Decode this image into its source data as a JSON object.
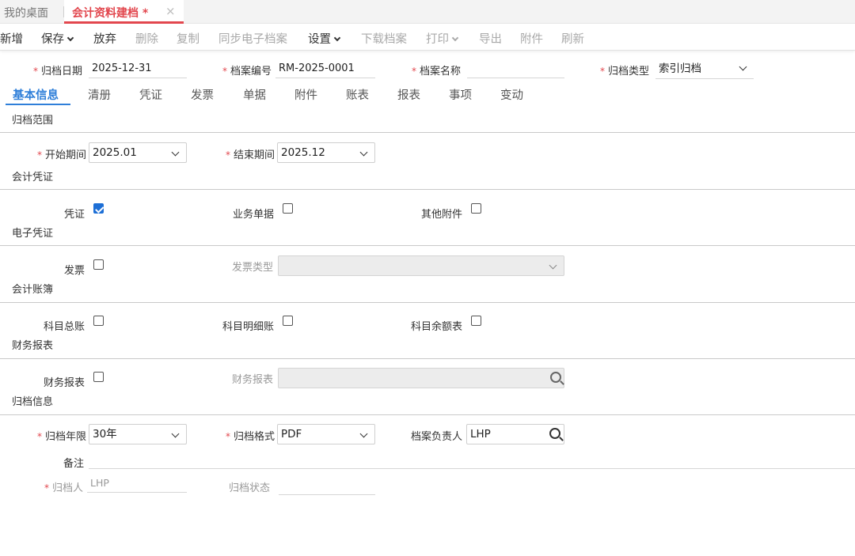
{
  "tabs": {
    "home": "我的桌面",
    "active": "会计资料建档 *",
    "close": "×"
  },
  "toolbar": {
    "new": "新增",
    "save": "保存",
    "discard": "放弃",
    "delete": "删除",
    "copy": "复制",
    "sync": "同步电子档案",
    "settings": "设置",
    "download": "下载档案",
    "print": "打印",
    "export": "导出",
    "attachment": "附件",
    "refresh": "刷新"
  },
  "header": {
    "archive_date_label": "归档日期",
    "archive_date_value": "2025-12-31",
    "archive_no_label": "档案编号",
    "archive_no_value": "RM-2025-0001",
    "archive_name_label": "档案名称",
    "archive_name_value": "",
    "archive_type_label": "归档类型",
    "archive_type_value": "索引归档"
  },
  "section_tabs": [
    "基本信息",
    "清册",
    "凭证",
    "发票",
    "单据",
    "附件",
    "账表",
    "报表",
    "事项",
    "变动"
  ],
  "sections": {
    "scope": {
      "title": "归档范围",
      "start_label": "开始期间",
      "start_value": "2025.01",
      "end_label": "结束期间",
      "end_value": "2025.12"
    },
    "voucher": {
      "title": "会计凭证",
      "voucher_label": "凭证",
      "business_doc_label": "业务单据",
      "other_attach_label": "其他附件"
    },
    "e_voucher": {
      "title": "电子凭证",
      "invoice_label": "发票",
      "invoice_type_label": "发票类型",
      "invoice_type_value": ""
    },
    "ledger": {
      "title": "会计账簿",
      "general_label": "科目总账",
      "detail_label": "科目明细账",
      "balance_label": "科目余额表"
    },
    "report": {
      "title": "财务报表",
      "report_label": "财务报表",
      "report_select_label": "财务报表",
      "report_select_value": ""
    },
    "archive_info": {
      "title": "归档信息",
      "years_label": "归档年限",
      "years_value": "30年",
      "format_label": "归档格式",
      "format_value": "PDF",
      "owner_label": "档案负责人",
      "owner_value": "LHP",
      "remark_label": "备注",
      "remark_value": "",
      "archiver_label": "归档人",
      "archiver_value": "LHP",
      "status_label": "归档状态",
      "status_value": ""
    }
  },
  "colors": {
    "accent_red": "#e2474e",
    "accent_blue": "#2f7fd9",
    "checkbox_blue": "#1d6fd6"
  }
}
